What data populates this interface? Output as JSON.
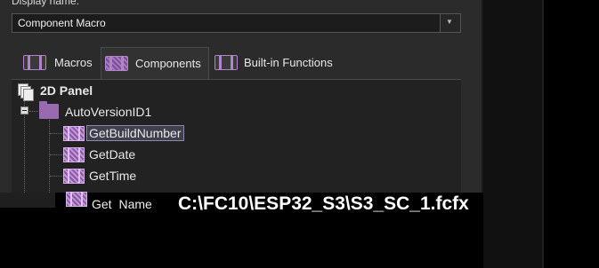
{
  "display_name": {
    "label": "Display name:",
    "value": "Component Macro"
  },
  "tabs": [
    {
      "label": "Macros",
      "icon": "macro-icon"
    },
    {
      "label": "Components",
      "icon": "component-icon",
      "active": true
    },
    {
      "label": "Built-in Functions",
      "icon": "builtin-function-icon"
    }
  ],
  "tree": {
    "root": {
      "label": "2D Panel",
      "icon": "panel-icon"
    },
    "component": {
      "label": "AutoVersionID1",
      "icon": "folder-icon",
      "expanded": true
    },
    "macros": [
      {
        "label": "GetBuildNumber",
        "selected": true
      },
      {
        "label": "GetDate"
      },
      {
        "label": "GetTime"
      },
      {
        "label": "Get Name"
      }
    ]
  },
  "file_path": "C:\\FC10\\ESP32_S3\\S3_SC_1.fcfx",
  "colors": {
    "panel_bg": "#2b2b2b",
    "tree_bg": "#222222",
    "accent_purple": "#9a6ab0",
    "selection_border": "#8a8aa8"
  }
}
